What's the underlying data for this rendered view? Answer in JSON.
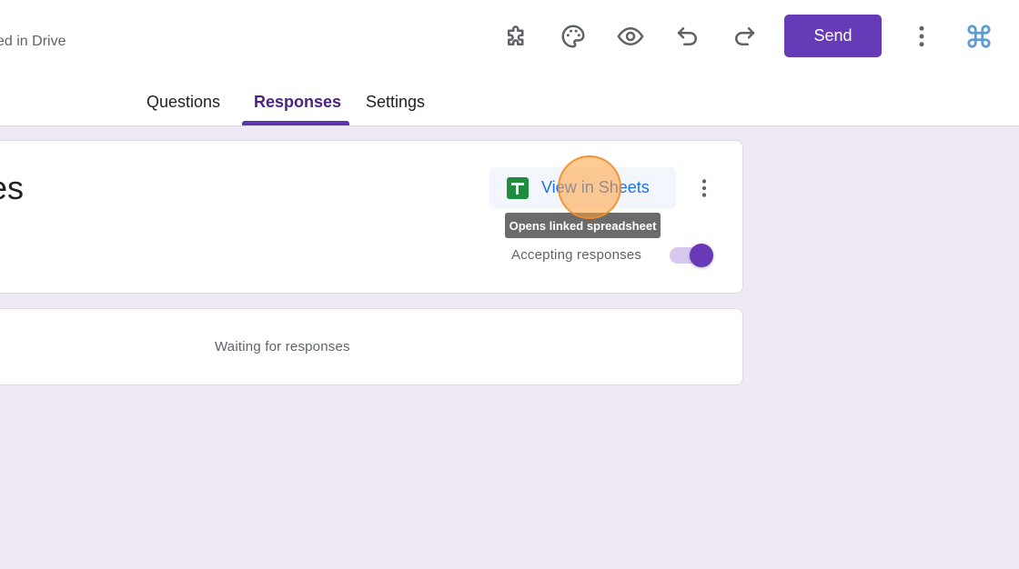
{
  "header": {
    "saved_status": "ed in Drive",
    "send_label": "Send",
    "icons": [
      "extension-icon",
      "palette-icon",
      "preview-eye-icon",
      "undo-icon",
      "redo-icon",
      "more-vert-icon",
      "command-icon"
    ]
  },
  "tabs": [
    {
      "label": "Questions",
      "active": false
    },
    {
      "label": "Responses",
      "active": true
    },
    {
      "label": "Settings",
      "active": false
    }
  ],
  "summary": {
    "title_fragment": "ses",
    "sheets_button_label": "View in Sheets",
    "tooltip": "Opens linked spreadsheet",
    "accepting_label": "Accepting responses",
    "accepting": true
  },
  "waiting": {
    "text": "Waiting for responses"
  },
  "colors": {
    "brand": "#673ab7",
    "background": "#efe9f6",
    "link": "#1a73e8",
    "sheets_green": "#1e8e3e"
  }
}
